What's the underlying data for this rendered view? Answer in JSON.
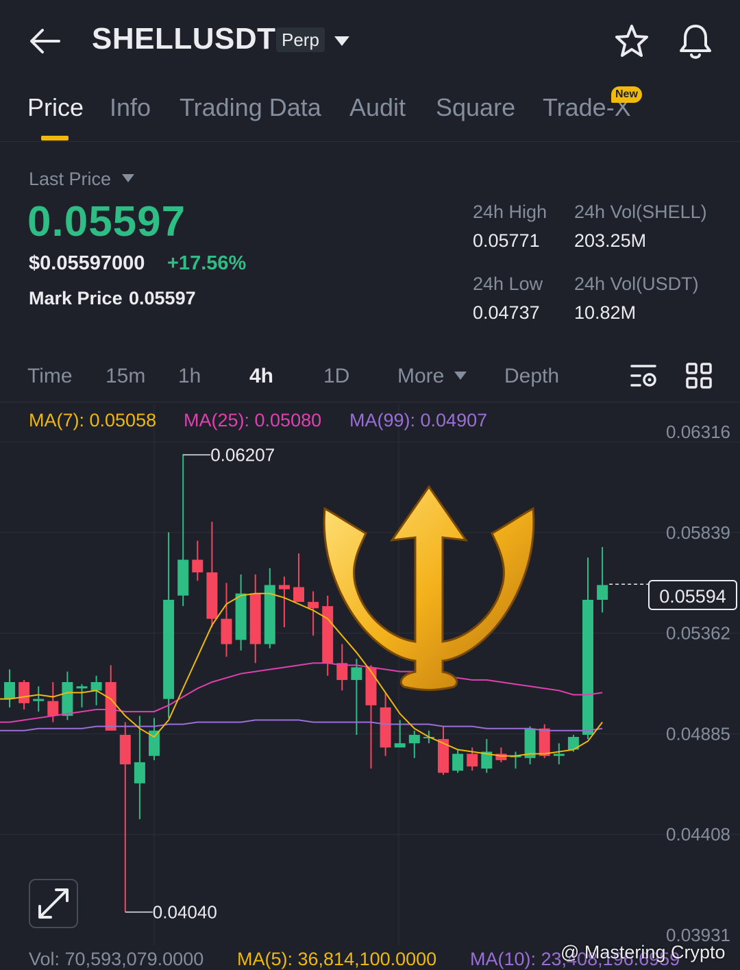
{
  "header": {
    "symbol": "SHELLUSDT",
    "badge": "Perp",
    "icons": [
      "back-arrow-icon",
      "dropdown-caret-icon",
      "star-icon",
      "bell-icon"
    ]
  },
  "tabs": [
    {
      "label": "Price",
      "active": true
    },
    {
      "label": "Info"
    },
    {
      "label": "Trading Data"
    },
    {
      "label": "Audit"
    },
    {
      "label": "Square"
    },
    {
      "label": "Trade-X",
      "badge": "New"
    }
  ],
  "price": {
    "last_price_label": "Last Price",
    "last_price": "0.05597",
    "usd_price": "$0.05597000",
    "change_pct": "+17.56%",
    "mark_label": "Mark Price",
    "mark_value": "0.05597"
  },
  "stats": {
    "high_label": "24h High",
    "high_value": "0.05771",
    "vol_shell_label": "24h Vol(SHELL)",
    "vol_shell_value": "203.25M",
    "low_label": "24h Low",
    "low_value": "0.04737",
    "vol_usdt_label": "24h Vol(USDT)",
    "vol_usdt_value": "10.82M"
  },
  "intervals": {
    "time": "Time",
    "m15": "15m",
    "h1": "1h",
    "h4": "4h",
    "d1": "1D",
    "more": "More",
    "depth": "Depth",
    "active": "4h"
  },
  "ma_legend": {
    "ma7": "MA(7): 0.05058",
    "ma25": "MA(25): 0.05080",
    "ma99": "MA(99): 0.04907"
  },
  "volume_legend": {
    "vol": "Vol: 70,593,079.0000",
    "ma5": "MA(5): 36,814,100.0000",
    "ma10": "MA(10): 23,408,196.6959"
  },
  "watermark": "@ Mastering Crypto",
  "colors": {
    "up": "#2ebd85",
    "down": "#f6465d",
    "accent": "#f0b90b",
    "ma7": "#f0b90b",
    "ma25": "#e040b0",
    "ma99": "#9b6fd6"
  },
  "chart_data": {
    "type": "candlestick",
    "y_ticks": [
      "0.06316",
      "0.05839",
      "0.05362",
      "0.04885",
      "0.04408",
      "0.03931"
    ],
    "ylim": [
      0.03931,
      0.06316
    ],
    "high_annotation": "0.06207",
    "low_annotation": "0.04040",
    "current_price": "0.05594",
    "candles": [
      {
        "o": 0.0505,
        "h": 0.0519,
        "l": 0.0501,
        "c": 0.0513
      },
      {
        "o": 0.0513,
        "h": 0.0514,
        "l": 0.05,
        "c": 0.0503
      },
      {
        "o": 0.0504,
        "h": 0.0511,
        "l": 0.0499,
        "c": 0.0505
      },
      {
        "o": 0.0504,
        "h": 0.0513,
        "l": 0.0494,
        "c": 0.0497
      },
      {
        "o": 0.0497,
        "h": 0.0518,
        "l": 0.0495,
        "c": 0.0513
      },
      {
        "o": 0.051,
        "h": 0.0512,
        "l": 0.0501,
        "c": 0.0511
      },
      {
        "o": 0.0509,
        "h": 0.0516,
        "l": 0.0502,
        "c": 0.0513
      },
      {
        "o": 0.0513,
        "h": 0.0521,
        "l": 0.0492,
        "c": 0.049
      },
      {
        "o": 0.0488,
        "h": 0.0494,
        "l": 0.0404,
        "c": 0.0474
      },
      {
        "o": 0.0465,
        "h": 0.0497,
        "l": 0.0448,
        "c": 0.0475
      },
      {
        "o": 0.0478,
        "h": 0.0496,
        "l": 0.0476,
        "c": 0.049
      },
      {
        "o": 0.0505,
        "h": 0.0584,
        "l": 0.0496,
        "c": 0.0552
      },
      {
        "o": 0.0554,
        "h": 0.0621,
        "l": 0.0549,
        "c": 0.0571
      },
      {
        "o": 0.0571,
        "h": 0.058,
        "l": 0.0561,
        "c": 0.0565
      },
      {
        "o": 0.0565,
        "h": 0.0589,
        "l": 0.0539,
        "c": 0.0543
      },
      {
        "o": 0.0543,
        "h": 0.056,
        "l": 0.0525,
        "c": 0.0531
      },
      {
        "o": 0.0533,
        "h": 0.0564,
        "l": 0.0528,
        "c": 0.0555
      },
      {
        "o": 0.0555,
        "h": 0.0564,
        "l": 0.0522,
        "c": 0.0531
      },
      {
        "o": 0.0531,
        "h": 0.0567,
        "l": 0.0529,
        "c": 0.0559
      },
      {
        "o": 0.0559,
        "h": 0.0563,
        "l": 0.0539,
        "c": 0.0557
      },
      {
        "o": 0.0558,
        "h": 0.0574,
        "l": 0.0551,
        "c": 0.0551
      },
      {
        "o": 0.0551,
        "h": 0.0556,
        "l": 0.0535,
        "c": 0.0548
      },
      {
        "o": 0.0549,
        "h": 0.0554,
        "l": 0.0516,
        "c": 0.0522
      },
      {
        "o": 0.0522,
        "h": 0.0531,
        "l": 0.0509,
        "c": 0.0514
      },
      {
        "o": 0.0514,
        "h": 0.0524,
        "l": 0.0488,
        "c": 0.052
      },
      {
        "o": 0.052,
        "h": 0.0521,
        "l": 0.0472,
        "c": 0.0502
      },
      {
        "o": 0.0501,
        "h": 0.0508,
        "l": 0.0478,
        "c": 0.0482
      },
      {
        "o": 0.0482,
        "h": 0.0495,
        "l": 0.0482,
        "c": 0.0484
      },
      {
        "o": 0.0484,
        "h": 0.049,
        "l": 0.0477,
        "c": 0.0488
      },
      {
        "o": 0.0487,
        "h": 0.049,
        "l": 0.0484,
        "c": 0.0487
      },
      {
        "o": 0.0486,
        "h": 0.0492,
        "l": 0.0469,
        "c": 0.047
      },
      {
        "o": 0.0471,
        "h": 0.0481,
        "l": 0.047,
        "c": 0.0479
      },
      {
        "o": 0.0479,
        "h": 0.0482,
        "l": 0.0471,
        "c": 0.0473
      },
      {
        "o": 0.0472,
        "h": 0.0486,
        "l": 0.047,
        "c": 0.048
      },
      {
        "o": 0.0479,
        "h": 0.0482,
        "l": 0.0475,
        "c": 0.0476
      },
      {
        "o": 0.0478,
        "h": 0.048,
        "l": 0.0472,
        "c": 0.0478
      },
      {
        "o": 0.0477,
        "h": 0.0492,
        "l": 0.0474,
        "c": 0.0491
      },
      {
        "o": 0.0491,
        "h": 0.0493,
        "l": 0.0477,
        "c": 0.0478
      },
      {
        "o": 0.0478,
        "h": 0.0484,
        "l": 0.0474,
        "c": 0.0479
      },
      {
        "o": 0.0481,
        "h": 0.0488,
        "l": 0.048,
        "c": 0.0487
      },
      {
        "o": 0.0488,
        "h": 0.0572,
        "l": 0.0486,
        "c": 0.0552
      },
      {
        "o": 0.0552,
        "h": 0.0577,
        "l": 0.0546,
        "c": 0.0559
      }
    ],
    "ma7": [
      0.0505,
      0.0506,
      0.0507,
      0.0506,
      0.0508,
      0.0508,
      0.0509,
      0.0505,
      0.0497,
      0.0491,
      0.0487,
      0.0495,
      0.051,
      0.0525,
      0.054,
      0.055,
      0.0554,
      0.0555,
      0.0555,
      0.0553,
      0.055,
      0.0547,
      0.0543,
      0.0535,
      0.0527,
      0.0518,
      0.0508,
      0.0498,
      0.0491,
      0.0487,
      0.0484,
      0.0481,
      0.048,
      0.0479,
      0.0478,
      0.0478,
      0.0479,
      0.0479,
      0.048,
      0.0481,
      0.0485,
      0.0494
    ],
    "ma25": [
      0.0494,
      0.0495,
      0.0496,
      0.0497,
      0.0498,
      0.0499,
      0.05,
      0.05,
      0.0499,
      0.0499,
      0.0499,
      0.0502,
      0.0506,
      0.051,
      0.0513,
      0.0515,
      0.0517,
      0.0518,
      0.0519,
      0.052,
      0.0521,
      0.0522,
      0.0522,
      0.0521,
      0.0521,
      0.052,
      0.0519,
      0.0518,
      0.0518,
      0.0517,
      0.0516,
      0.0515,
      0.0514,
      0.0514,
      0.0513,
      0.0512,
      0.0511,
      0.051,
      0.0509,
      0.0507,
      0.0507,
      0.0508
    ],
    "ma99": [
      0.049,
      0.049,
      0.0491,
      0.0491,
      0.0491,
      0.0491,
      0.0492,
      0.0492,
      0.0492,
      0.0492,
      0.0492,
      0.0493,
      0.0493,
      0.0494,
      0.0494,
      0.0494,
      0.0494,
      0.0495,
      0.0495,
      0.0495,
      0.0495,
      0.0494,
      0.0494,
      0.0494,
      0.0494,
      0.0494,
      0.0493,
      0.0493,
      0.0493,
      0.0493,
      0.0492,
      0.0492,
      0.0492,
      0.0491,
      0.0491,
      0.0491,
      0.0491,
      0.049,
      0.049,
      0.049,
      0.049,
      0.0491
    ]
  }
}
